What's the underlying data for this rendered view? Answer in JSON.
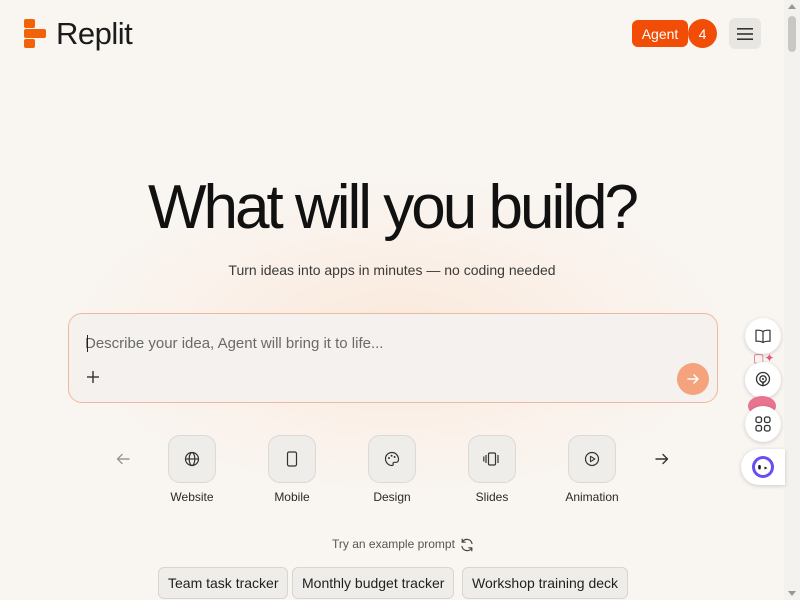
{
  "header": {
    "brand": "Replit",
    "agent_label": "Agent",
    "agent_count": "4"
  },
  "hero": {
    "title": "What will you build?",
    "subtitle": "Turn ideas into apps in minutes — no coding needed"
  },
  "prompt": {
    "placeholder": "Describe your idea, Agent will bring it to life...",
    "value": ""
  },
  "app_types": [
    {
      "label": "Website",
      "icon": "globe-icon"
    },
    {
      "label": "Mobile",
      "icon": "phone-icon"
    },
    {
      "label": "Design",
      "icon": "palette-icon"
    },
    {
      "label": "Slides",
      "icon": "slides-icon"
    },
    {
      "label": "Animation",
      "icon": "play-icon"
    }
  ],
  "examples": {
    "label": "Try an example prompt",
    "chips": [
      "Team task tracker",
      "Monthly budget tracker",
      "Workshop training deck"
    ]
  },
  "colors": {
    "brand": "#f26207",
    "agent": "#f14d06",
    "send": "#f5a37c",
    "background": "#f9f6f2"
  }
}
